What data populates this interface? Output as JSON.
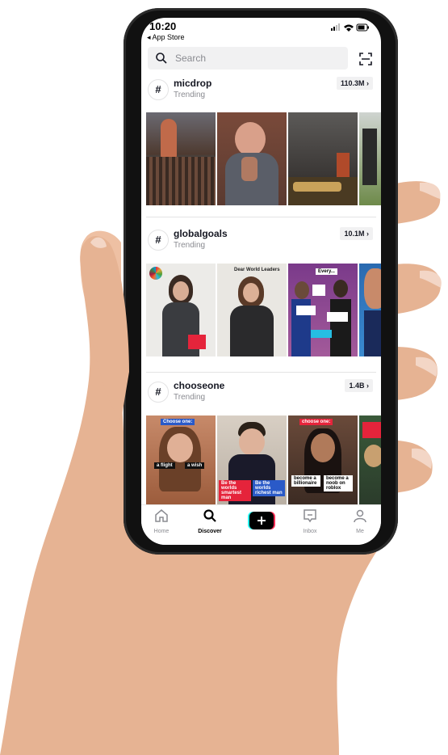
{
  "status_bar": {
    "time": "10:20",
    "back_label": "◂ App Store"
  },
  "search": {
    "placeholder": "Search"
  },
  "sections": [
    {
      "tag": "micdrop",
      "subtitle": "Trending",
      "count": "110.3M ›"
    },
    {
      "tag": "globalgoals",
      "subtitle": "Trending",
      "count": "10.1M ›"
    },
    {
      "tag": "chooseone",
      "subtitle": "Trending",
      "count": "1.4B ›"
    }
  ],
  "thumb_captions": {
    "globalgoals_2": "Dear World Leaders",
    "globalgoals_3": "Every...",
    "chooseone_1": "Choose one:",
    "chooseone_3": "choose one:",
    "chooseone_1_a": "a flight",
    "chooseone_1_b": "a wish",
    "chooseone_2_a": "Be the worlds smartest man",
    "chooseone_2_b": "Be the worlds richest man",
    "chooseone_3_a": "become a billionaire",
    "chooseone_3_b": "become a noob on roblox"
  },
  "tabs": {
    "home": "Home",
    "discover": "Discover",
    "inbox": "Inbox",
    "me": "Me"
  },
  "colors": {
    "accent_red": "#fe2c55",
    "accent_cyan": "#25f4ee",
    "bezel": "#111111",
    "skin": "#e8b89a"
  }
}
